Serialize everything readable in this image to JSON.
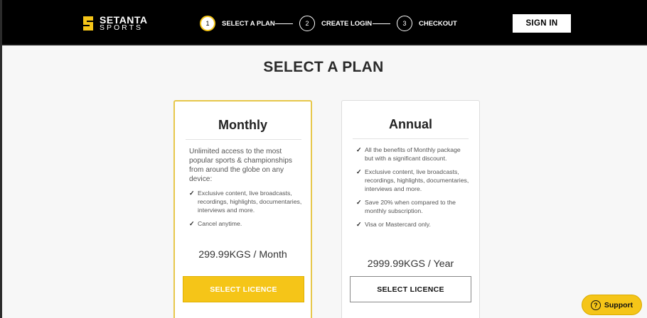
{
  "header": {
    "logo_line1": "SETANTA",
    "logo_line2": "SPORTS",
    "steps": [
      {
        "number": "1",
        "label": "SELECT A PLAN"
      },
      {
        "number": "2",
        "label": "CREATE LOGIN"
      },
      {
        "number": "3",
        "label": "CHECKOUT"
      }
    ],
    "signin_label": "SIGN IN"
  },
  "main": {
    "title": "SELECT A PLAN",
    "plans": [
      {
        "title": "Monthly",
        "description": "Unlimited access to the most popular sports & championships from around the globe on any device:",
        "features": [
          "Exclusive content, live broadcasts, recordings, highlights, documentaries, interviews and more.",
          "Cancel anytime."
        ],
        "price": "299.99KGS / Month",
        "button_label": "SELECT LICENCE"
      },
      {
        "title": "Annual",
        "features": [
          "All the benefits of Monthly package but with a significant discount.",
          "Exclusive content, live broadcasts, recordings, highlights, documentaries, interviews and more.",
          "Save 20% when compared to the monthly subscription.",
          "Visa or Mastercard only."
        ],
        "price": "2999.99KGS / Year",
        "button_label": "SELECT LICENCE"
      }
    ]
  },
  "support": {
    "label": "Support",
    "icon": "question-icon",
    "icon_glyph": "?"
  },
  "colors": {
    "accent": "#f5c518",
    "header_bg": "#000000",
    "page_bg": "#f7f7f7"
  }
}
